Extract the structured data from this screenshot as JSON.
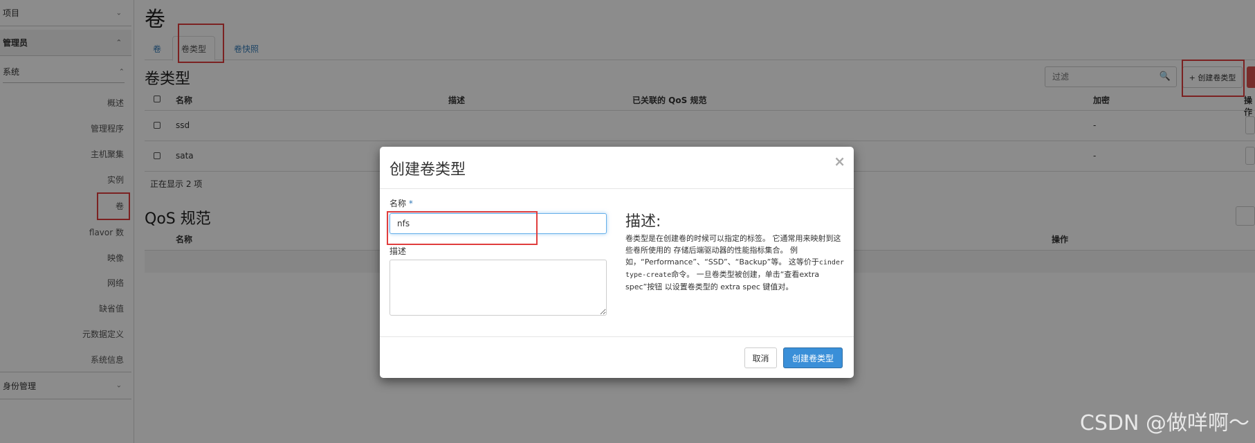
{
  "sidebar": {
    "sections": [
      {
        "label": "项目"
      },
      {
        "label": "管理员"
      },
      {
        "label": "身份管理"
      }
    ],
    "system_label": "系统",
    "items": [
      {
        "label": "概述"
      },
      {
        "label": "管理程序"
      },
      {
        "label": "主机聚集"
      },
      {
        "label": "实例"
      },
      {
        "label": "卷"
      },
      {
        "label": "flavor 数"
      },
      {
        "label": "映像"
      },
      {
        "label": "网络"
      },
      {
        "label": "缺省值"
      },
      {
        "label": "元数据定义"
      },
      {
        "label": "系统信息"
      }
    ]
  },
  "page": {
    "title": "卷",
    "tabs": [
      {
        "label": "卷"
      },
      {
        "label": "卷类型"
      },
      {
        "label": "卷快照"
      }
    ]
  },
  "volume_types": {
    "title": "卷类型",
    "filter_placeholder": "过滤",
    "create_button": "+ 创建卷类型",
    "columns": [
      "名称",
      "描述",
      "已关联的 QoS 规范",
      "加密",
      "操作"
    ],
    "rows": [
      {
        "name": "ssd",
        "encryption": "-"
      },
      {
        "name": "sata",
        "encryption": "-"
      }
    ],
    "footer": "正在显示 2 项"
  },
  "qos": {
    "title": "QoS 规范",
    "columns": [
      "名称",
      "操作"
    ]
  },
  "modal": {
    "title": "创建卷类型",
    "close": "×",
    "name_label": "名称",
    "required_mark": "*",
    "name_value": "nfs",
    "desc_label": "描述",
    "help_title": "描述:",
    "help_part1": "卷类型是在创建卷的时候可以指定的标签。 它通常用来映射到这些卷所使用的 存储后端驱动器的性能指标集合。 例如，“Performance”、“SSD”、“Backup”等。 这等价于",
    "help_code": "cinder type-create",
    "help_part2": "命令。 一旦卷类型被创建，单击“查看extra spec”按钮 以设置卷类型的 extra spec 键值对。",
    "cancel": "取消",
    "submit": "创建卷类型"
  },
  "watermark": "CSDN @做咩啊～",
  "colors": {
    "accent": "#3a8fd8",
    "highlight": "#e03d3d",
    "link": "#337ab7"
  }
}
